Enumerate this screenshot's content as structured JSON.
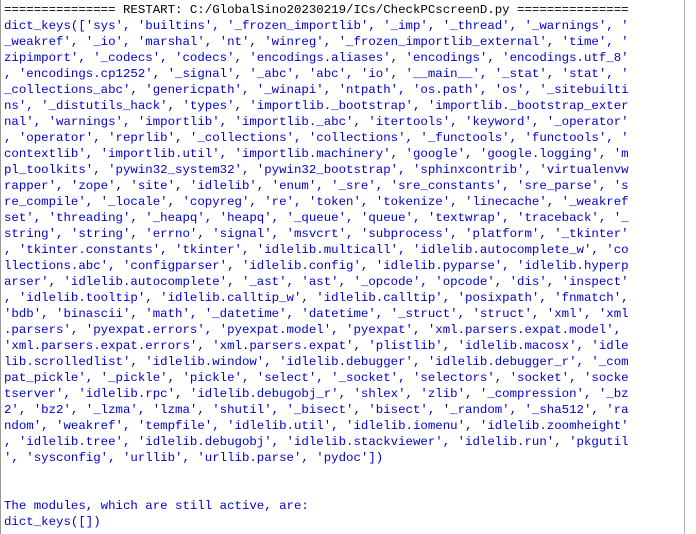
{
  "window": {
    "app": "Python IDLE Shell",
    "background_color": "#ffffff",
    "text_color": "#0000cd",
    "restart_text_color": "#000000",
    "border_color": "#9a9a9a"
  },
  "shell": {
    "restart_banner": "=============== RESTART: C:/GlobalSino20230219/ICs/CheckPCscreenD.py ===============",
    "restart_path": "C:/GlobalSino20230219/ICs/CheckPCscreenD.py",
    "lines": [
      "dict_keys(['sys', 'builtins', '_frozen_importlib', '_imp', '_thread', '_warnings', '",
      "_weakref', '_io', 'marshal', 'nt', 'winreg', '_frozen_importlib_external', 'time', '",
      "zipimport', '_codecs', 'codecs', 'encodings.aliases', 'encodings', 'encodings.utf_8'",
      ", 'encodings.cp1252', '_signal', '_abc', 'abc', 'io', '__main__', '_stat', 'stat', '",
      "_collections_abc', 'genericpath', '_winapi', 'ntpath', 'os.path', 'os', '_sitebuilti",
      "ns', '_distutils_hack', 'types', 'importlib._bootstrap', 'importlib._bootstrap_exter",
      "nal', 'warnings', 'importlib', 'importlib._abc', 'itertools', 'keyword', '_operator'",
      ", 'operator', 'reprlib', '_collections', 'collections', '_functools', 'functools', '",
      "contextlib', 'importlib.util', 'importlib.machinery', 'google', 'google.logging', 'm",
      "pl_toolkits', 'pywin32_system32', 'pywin32_bootstrap', 'sphinxcontrib', 'virtualenvw",
      "rapper', 'zope', 'site', 'idlelib', 'enum', '_sre', 'sre_constants', 'sre_parse', 's",
      "re_compile', '_locale', 'copyreg', 're', 'token', 'tokenize', 'linecache', '_weakref",
      "set', 'threading', '_heapq', 'heapq', '_queue', 'queue', 'textwrap', 'traceback', '_",
      "string', 'string', 'errno', 'signal', 'msvcrt', 'subprocess', 'platform', '_tkinter'",
      ", 'tkinter.constants', 'tkinter', 'idlelib.multicall', 'idlelib.autocomplete_w', 'co",
      "llections.abc', 'configparser', 'idlelib.config', 'idlelib.pyparse', 'idlelib.hyperp",
      "arser', 'idlelib.autocomplete', '_ast', 'ast', '_opcode', 'opcode', 'dis', 'inspect'",
      ", 'idlelib.tooltip', 'idlelib.calltip_w', 'idlelib.calltip', 'posixpath', 'fnmatch',",
      "'bdb', 'binascii', 'math', '_datetime', 'datetime', '_struct', 'struct', 'xml', 'xml",
      ".parsers', 'pyexpat.errors', 'pyexpat.model', 'pyexpat', 'xml.parsers.expat.model',",
      "'xml.parsers.expat.errors', 'xml.parsers.expat', 'plistlib', 'idlelib.macosx', 'idle",
      "lib.scrolledlist', 'idlelib.window', 'idlelib.debugger', 'idlelib.debugger_r', '_com",
      "pat_pickle', '_pickle', 'pickle', 'select', '_socket', 'selectors', 'socket', 'socke",
      "tserver', 'idlelib.rpc', 'idlelib.debugobj_r', 'shlex', 'zlib', '_compression', '_bz",
      "2', 'bz2', '_lzma', 'lzma', 'shutil', '_bisect', 'bisect', '_random', '_sha512', 'ra",
      "ndom', 'weakref', 'tempfile', 'idlelib.util', 'idlelib.iomenu', 'idlelib.zoomheight'",
      ", 'idlelib.tree', 'idlelib.debugobj', 'idlelib.stackviewer', 'idlelib.run', 'pkgutil",
      "', 'sysconfig', 'urllib', 'urllib.parse', 'pydoc'])",
      "",
      "",
      "The modules, which are still active, are:",
      "dict_keys([])"
    ]
  }
}
